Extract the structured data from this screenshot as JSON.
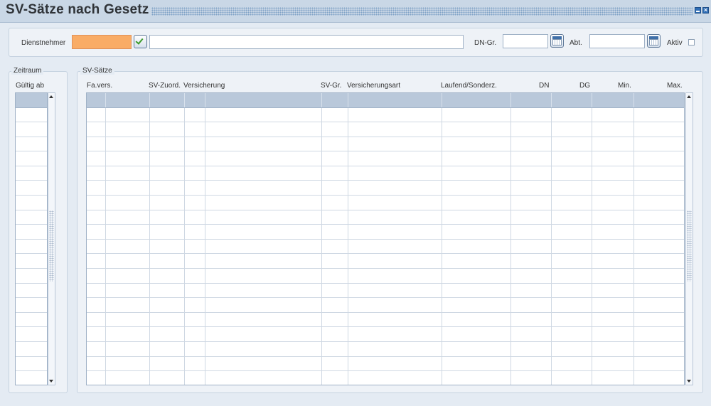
{
  "window": {
    "title": "SV-Sätze nach Gesetz"
  },
  "header": {
    "dienstnehmer_label": "Dienstnehmer",
    "dienstnehmer_value": "",
    "dienstnehmer_name": "",
    "dngr_label": "DN-Gr.",
    "dngr_value": "",
    "abt_label": "Abt.",
    "abt_value": "",
    "aktiv_label": "Aktiv",
    "aktiv_checked": false
  },
  "zeitraum": {
    "legend": "Zeitraum",
    "columns": [
      "Gültig ab"
    ],
    "row_count": 19
  },
  "svsaetze": {
    "legend": "SV-Sätze",
    "columns": [
      "Fa.vers.",
      "SV-Zuord.",
      "Versicherung",
      "",
      "SV-Gr.",
      "Versicherungsart",
      "Laufend/Sonderz.",
      "DN",
      "DG",
      "Min.",
      "Max."
    ],
    "row_count": 19
  },
  "colors": {
    "accent_orange": "#f9ac66",
    "titlebar": "#c9d7e6",
    "grid_header": "#b9c8da"
  },
  "icons": {
    "confirm": "check-icon",
    "calendar": "calendar-icon",
    "minimize": "minimize-icon",
    "close": "close-icon"
  }
}
